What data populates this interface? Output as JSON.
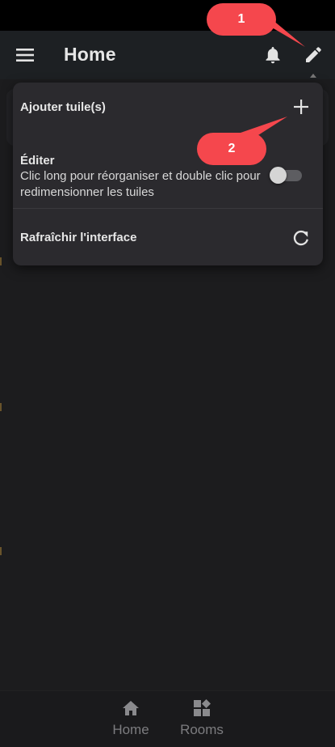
{
  "app_bar": {
    "title": "Home",
    "menu_icon": "hamburger-icon",
    "bell_icon": "bell-icon",
    "edit_icon": "pencil-icon"
  },
  "popup_menu": {
    "add_tiles": {
      "label": "Ajouter tuile(s)",
      "icon": "plus-icon"
    },
    "edit": {
      "label": "Éditer",
      "description": "Clic long pour réorganiser et double clic pour redimensionner les tuiles",
      "toggle_on": false
    },
    "refresh": {
      "label": "Rafraîchir l'interface",
      "icon": "refresh-icon"
    }
  },
  "annotations": [
    {
      "label": "1"
    },
    {
      "label": "2"
    }
  ],
  "bottom_nav": {
    "items": [
      {
        "label": "Home",
        "icon": "home-icon"
      },
      {
        "label": "Rooms",
        "icon": "rooms-grid-icon"
      }
    ]
  },
  "colors": {
    "annotation": "#f5474d",
    "background": "#1c1c1e",
    "popup": "#2b2a2e"
  }
}
